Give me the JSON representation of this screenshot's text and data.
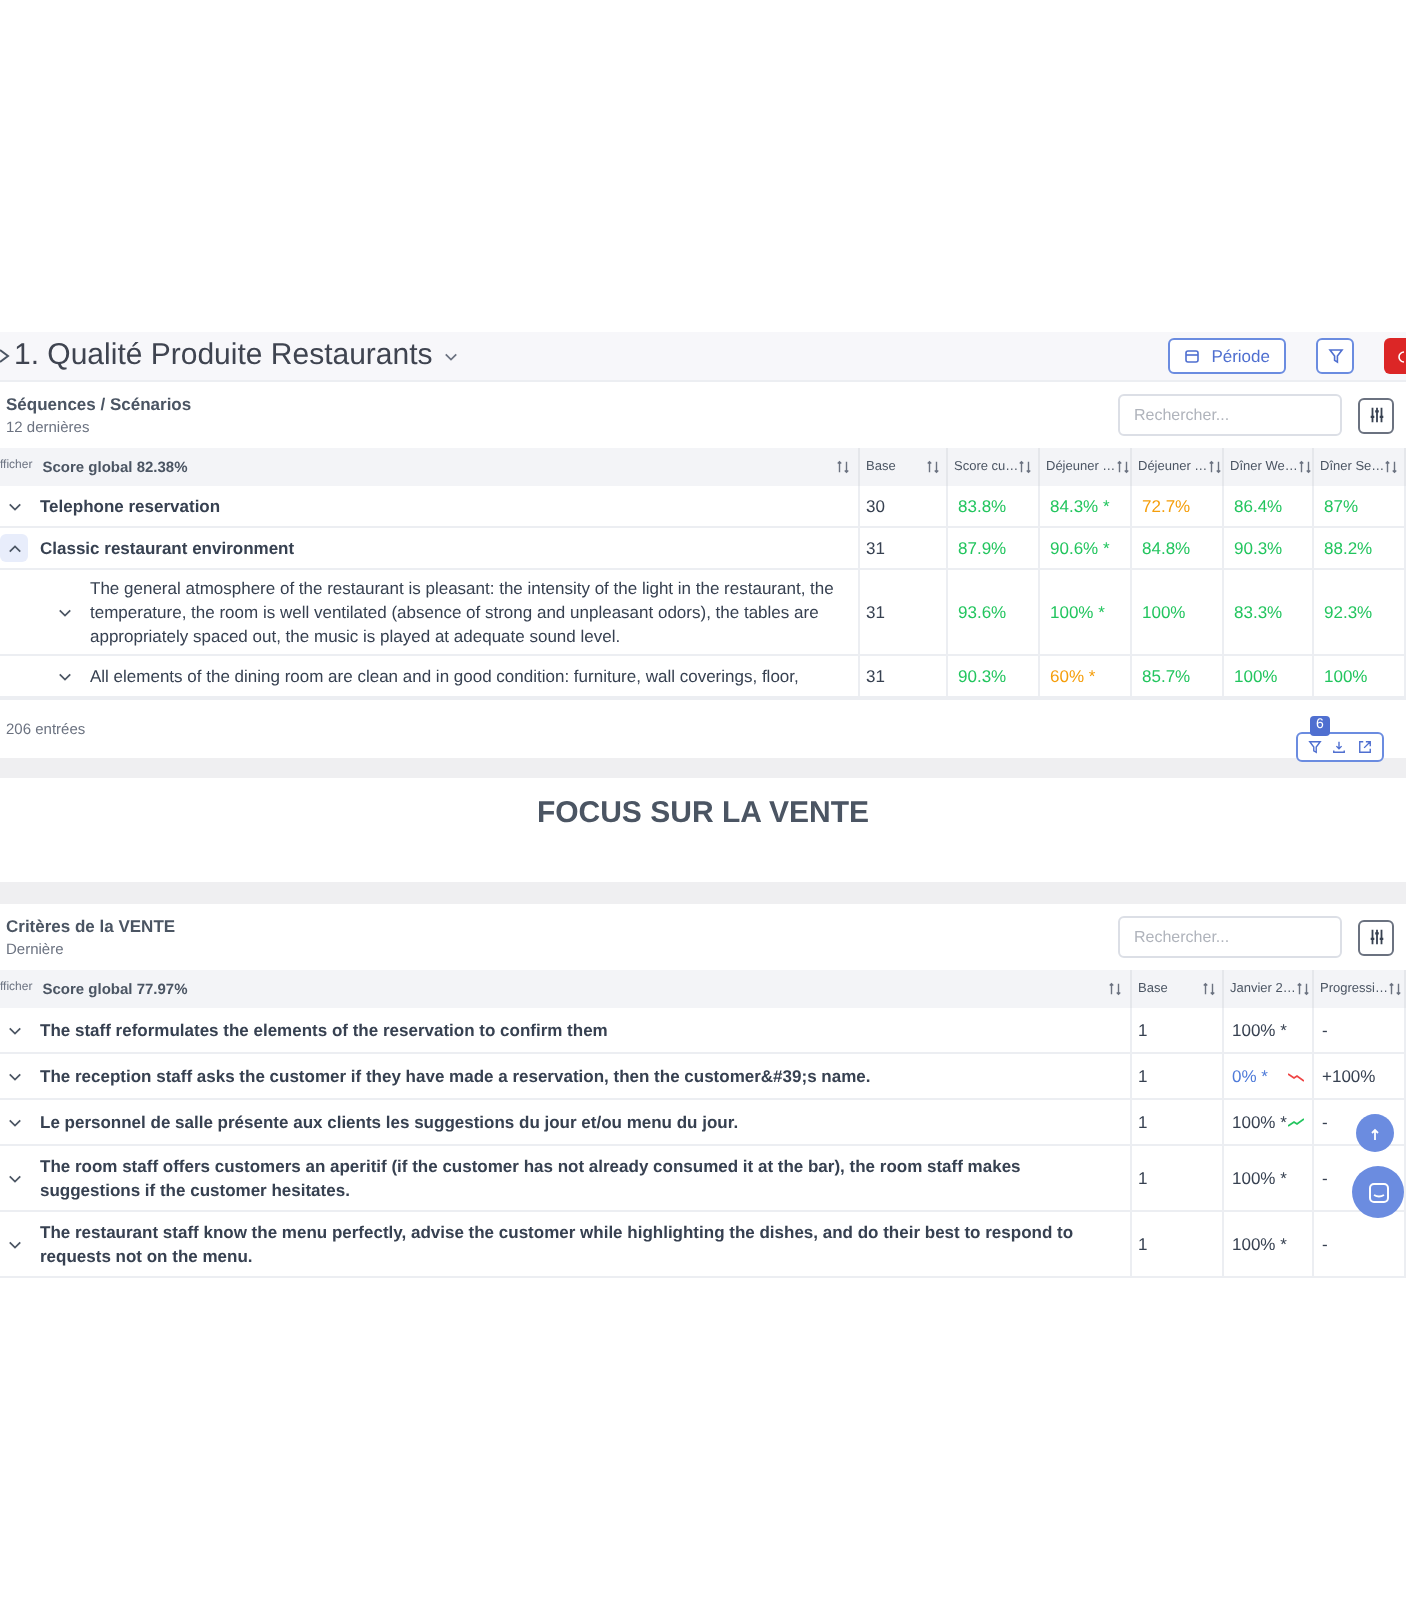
{
  "header": {
    "title": "1. Qualité Produite Restaurants",
    "buttons": [
      {
        "kind": "period",
        "label": "Période"
      },
      {
        "kind": "filter"
      },
      {
        "kind": "danger"
      }
    ]
  },
  "table_1": {
    "title": "Séquences / Scénarios",
    "subtitle": "12 dernières",
    "search": {
      "placeholder": "Rechercher..."
    },
    "show_label": "fficher",
    "score_label": "Score global 82.38%",
    "columns": [
      "Base",
      "Score cu…",
      "Déjeuner …",
      "Déjeuner …",
      "Dîner We…",
      "Dîner Se…"
    ],
    "rows": [
      {
        "label": "Telephone reservation",
        "expanded": false,
        "base": "30",
        "values": [
          {
            "text": "83.8%",
            "color": "#22c55e"
          },
          {
            "text": "84.3% *",
            "color": "#22c55e"
          },
          {
            "text": "72.7%",
            "color": "#f59e0b"
          },
          {
            "text": "86.4%",
            "color": "#22c55e"
          },
          {
            "text": "87%",
            "color": "#22c55e"
          }
        ]
      },
      {
        "label": "Classic restaurant environment",
        "expanded": true,
        "base": "31",
        "values": [
          {
            "text": "87.9%",
            "color": "#22c55e"
          },
          {
            "text": "90.6% *",
            "color": "#22c55e"
          },
          {
            "text": "84.8%",
            "color": "#22c55e"
          },
          {
            "text": "90.3%",
            "color": "#22c55e"
          },
          {
            "text": "88.2%",
            "color": "#22c55e"
          }
        ],
        "children": [
          {
            "label": "The general atmosphere of the restaurant is pleasant: the intensity of the light in the restaurant, the temperature, the room is well ventilated (absence of strong and unpleasant odors), the tables are appropriately spaced out, the music is played at adequate sound level.",
            "expanded": false,
            "base": "31",
            "values": [
              {
                "text": "93.6%",
                "color": "#22c55e"
              },
              {
                "text": "100% *",
                "color": "#22c55e"
              },
              {
                "text": "100%",
                "color": "#22c55e"
              },
              {
                "text": "83.3%",
                "color": "#22c55e"
              },
              {
                "text": "92.3%",
                "color": "#22c55e"
              }
            ]
          },
          {
            "label": "All elements of the dining room are clean and in good condition: furniture, wall coverings, floor,",
            "expanded": false,
            "base": "31",
            "values": [
              {
                "text": "90.3%",
                "color": "#22c55e"
              },
              {
                "text": "60% *",
                "color": "#f59e0b"
              },
              {
                "text": "85.7%",
                "color": "#22c55e"
              },
              {
                "text": "100%",
                "color": "#22c55e"
              },
              {
                "text": "100%",
                "color": "#22c55e"
              }
            ]
          }
        ]
      }
    ],
    "footer": "206 entrées",
    "toolbar": {
      "badge": "6"
    }
  },
  "section_title": "FOCUS SUR LA VENTE",
  "table_2": {
    "title": "Critères de la VENTE",
    "subtitle": "Dernière",
    "search": {
      "placeholder": "Rechercher..."
    },
    "show_label": "fficher",
    "score_label": "Score global 77.97%",
    "columns": [
      "Base",
      "Janvier 2…",
      "Progressi…"
    ],
    "rows": [
      {
        "label": "The staff reformulates the elements of the reservation to confirm them",
        "expanded": false,
        "base": "1",
        "value": {
          "kind": "plain",
          "text": "100% *",
          "color": "#374151"
        },
        "progress": "-"
      },
      {
        "label": "The reception staff asks the customer if they have made a reservation, then the customer&#39;s name.",
        "expanded": false,
        "base": "1",
        "value": {
          "kind": "falling",
          "text": "0% *",
          "color": "#4f7bd9"
        },
        "progress": "+100%"
      },
      {
        "label": "Le personnel de salle présente aux clients les suggestions du jour et/ou menu du jour.",
        "expanded": false,
        "base": "1",
        "value": {
          "kind": "rising",
          "text": "100% *",
          "color": "#374151"
        },
        "progress": "-"
      },
      {
        "label": "The room staff offers customers an aperitif (if the customer has not already consumed it at the bar), the room staff makes suggestions if the customer hesitates.",
        "expanded": false,
        "base": "1",
        "value": {
          "kind": "plain",
          "text": "100% *",
          "color": "#374151"
        },
        "progress": "-"
      },
      {
        "label": "The restaurant staff know the menu perfectly, advise the customer while highlighting the dishes, and do their best to respond to requests not on the menu.",
        "expanded": false,
        "base": "1",
        "value": {
          "kind": "plain",
          "text": "100% *",
          "color": "#374151"
        },
        "progress": "-"
      }
    ]
  }
}
